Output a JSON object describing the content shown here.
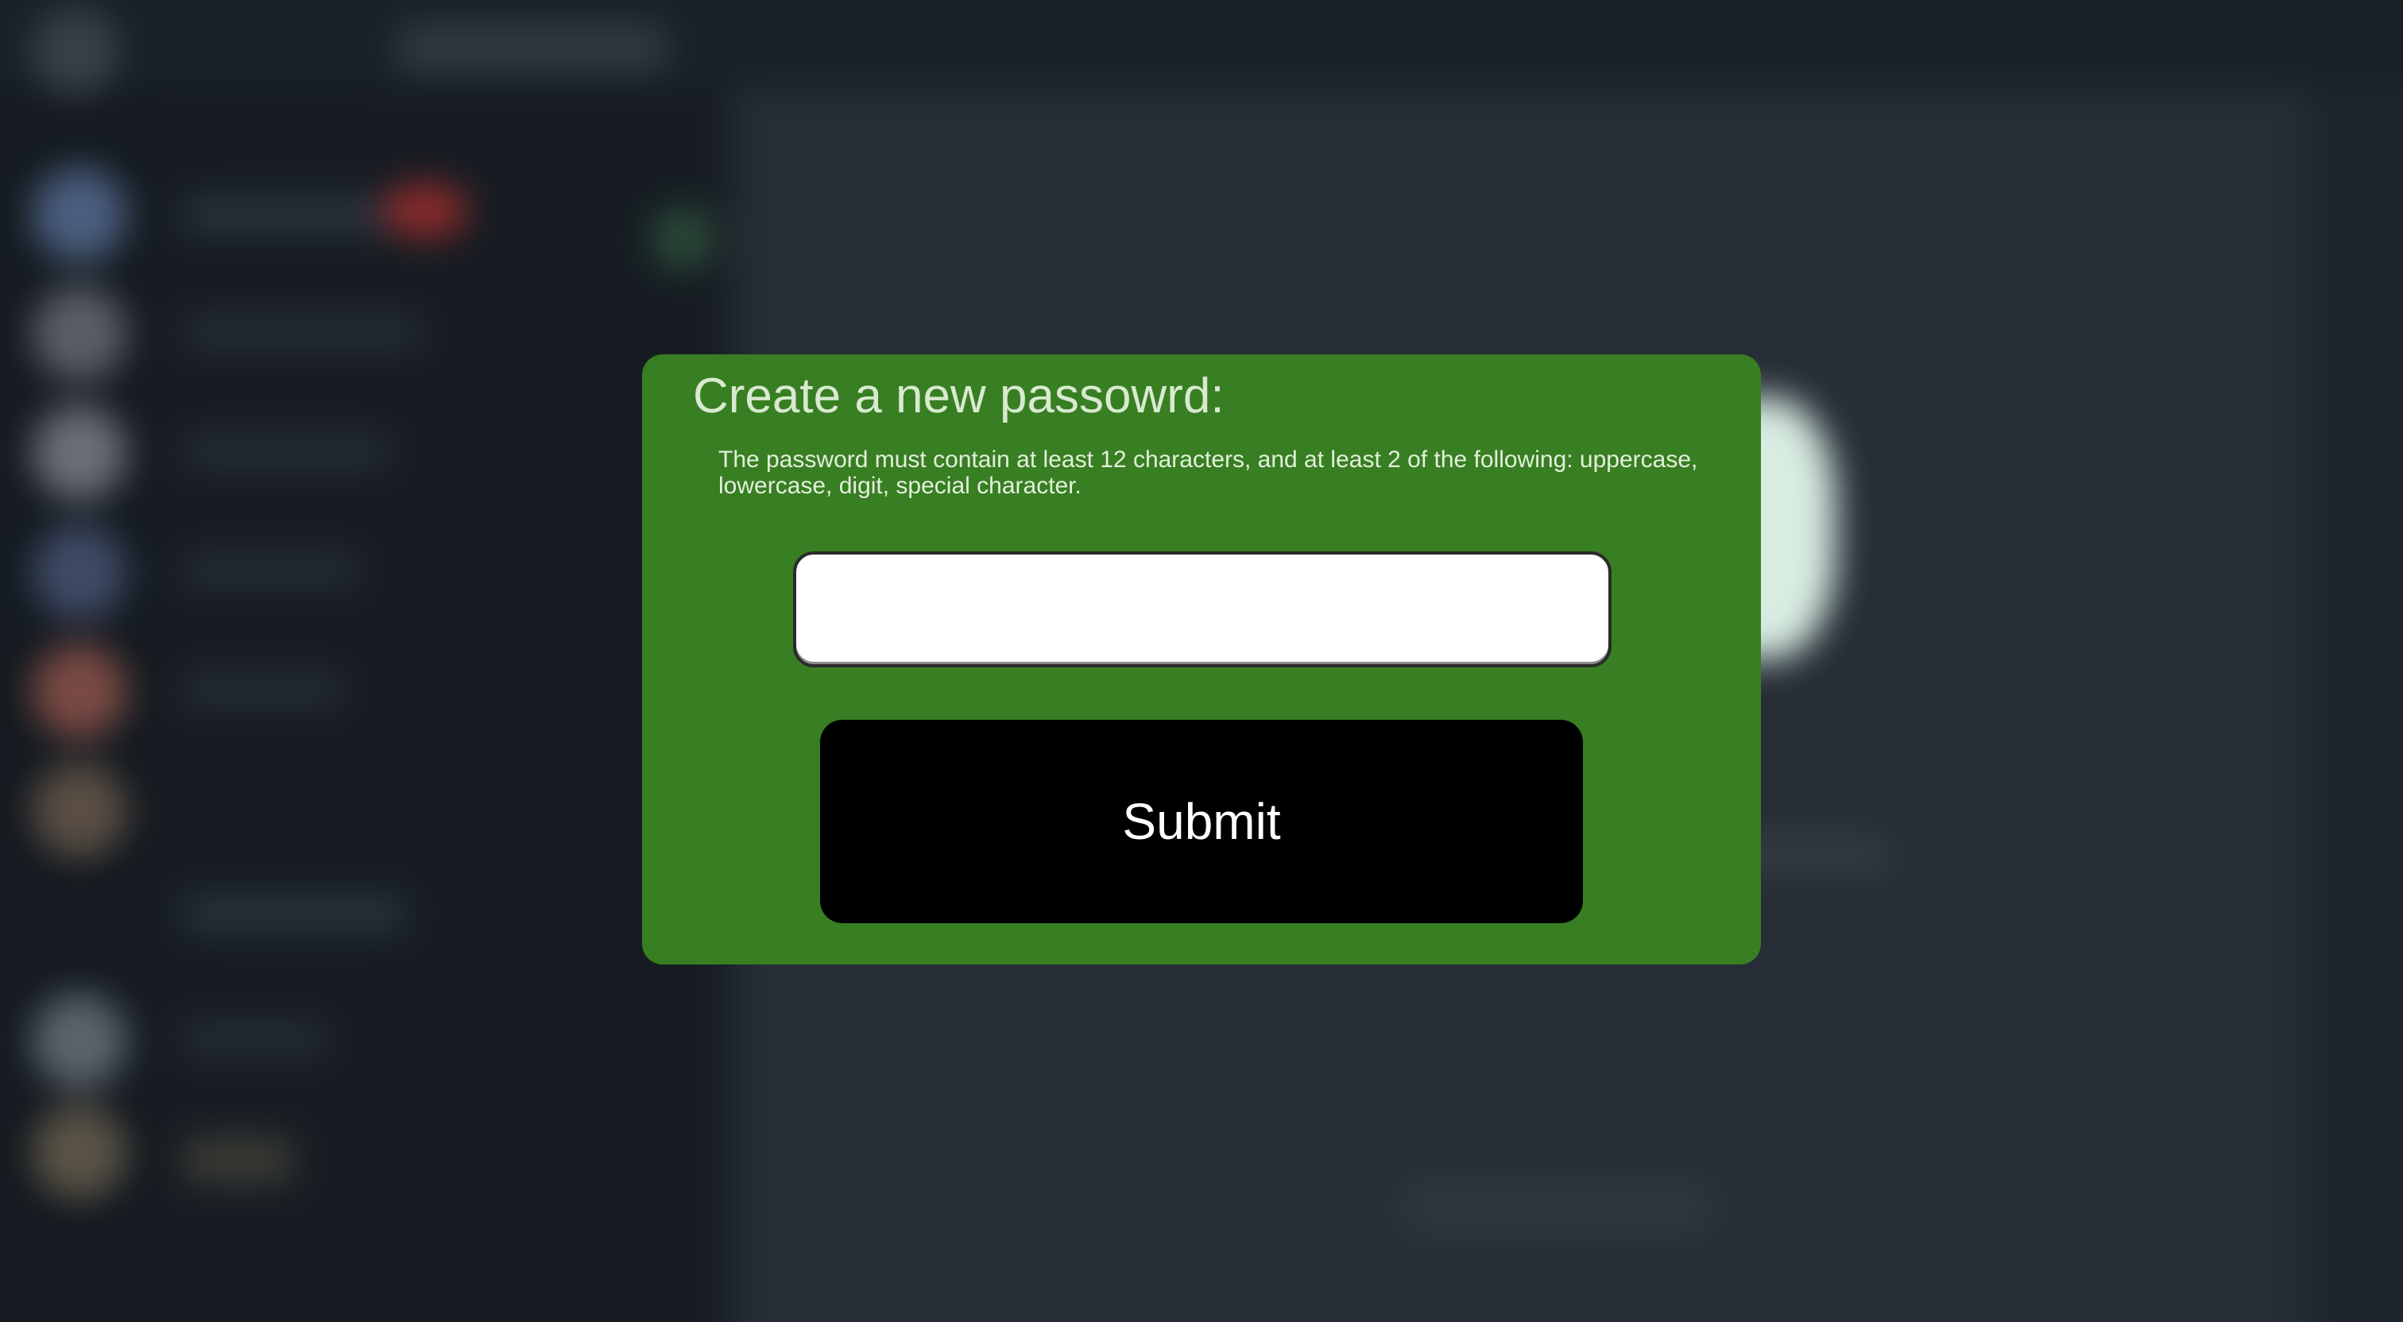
{
  "dialog": {
    "title": "Create a new passowrd:",
    "hint": "The password must contain at least 12 characters, and at least 2 of the following: uppercase, lowercase, digit, special character.",
    "password_input": {
      "value": "",
      "placeholder": ""
    },
    "submit_label": "Submit"
  },
  "colors": {
    "dialog_background": "#387e22",
    "submit_background": "#000000",
    "page_background": "#262d36"
  }
}
